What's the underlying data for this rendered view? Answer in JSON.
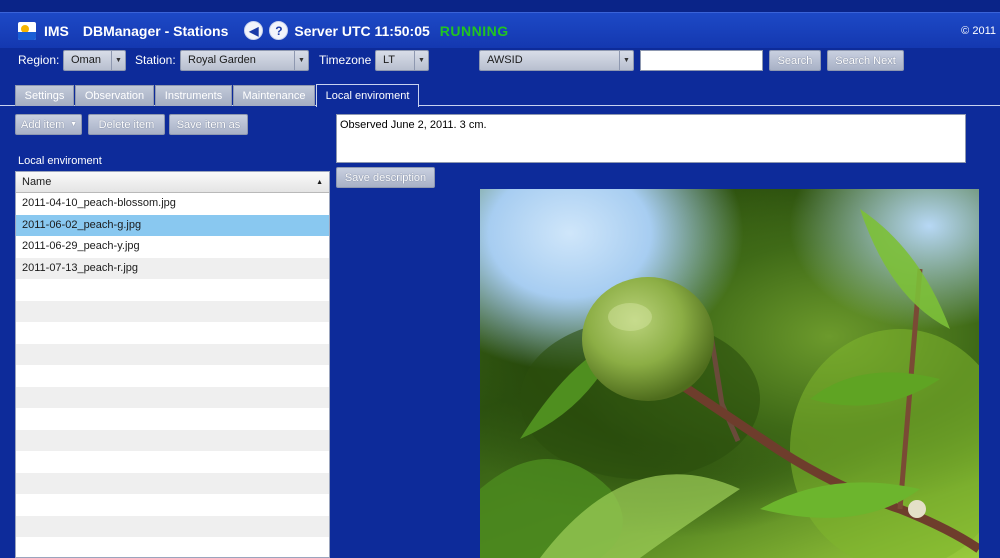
{
  "header": {
    "app_name": "IMS",
    "title": "DBManager - Stations",
    "back_icon": "back-arrow-icon",
    "help_icon": "help-icon",
    "server_time": "Server UTC 11:50:05",
    "status": "RUNNING",
    "status_color": "#21c421",
    "copyright": "© 2011"
  },
  "filters": {
    "region_label": "Region:",
    "region_value": "Oman",
    "station_label": "Station:",
    "station_value": "Royal Garden",
    "timezone_label": "Timezone",
    "timezone_value": "LT",
    "search_field_value": "AWSID",
    "search_input_value": "",
    "search_button": "Search",
    "search_next_button": "Search Next"
  },
  "tabs": [
    {
      "label": "Settings",
      "active": false
    },
    {
      "label": "Observation",
      "active": false
    },
    {
      "label": "Instruments",
      "active": false
    },
    {
      "label": "Maintenance",
      "active": false
    },
    {
      "label": "Local enviroment",
      "active": true
    }
  ],
  "toolbar": {
    "add_item": "Add item",
    "delete_item": "Delete item",
    "save_item_as": "Save item as"
  },
  "list": {
    "title": "Local enviroment",
    "column_name": "Name",
    "items": [
      "2011-04-10_peach-blossom.jpg",
      "2011-06-02_peach-g.jpg",
      "2011-06-29_peach-y.jpg",
      "2011-07-13_peach-r.jpg"
    ],
    "selected_index": 1
  },
  "description": {
    "text": "Observed June 2, 2011. 3 cm.",
    "save_button": "Save description"
  },
  "colors": {
    "background": "#0d2b9a",
    "titlebar": "#1d49c6",
    "selected_row": "#89c8f0"
  }
}
